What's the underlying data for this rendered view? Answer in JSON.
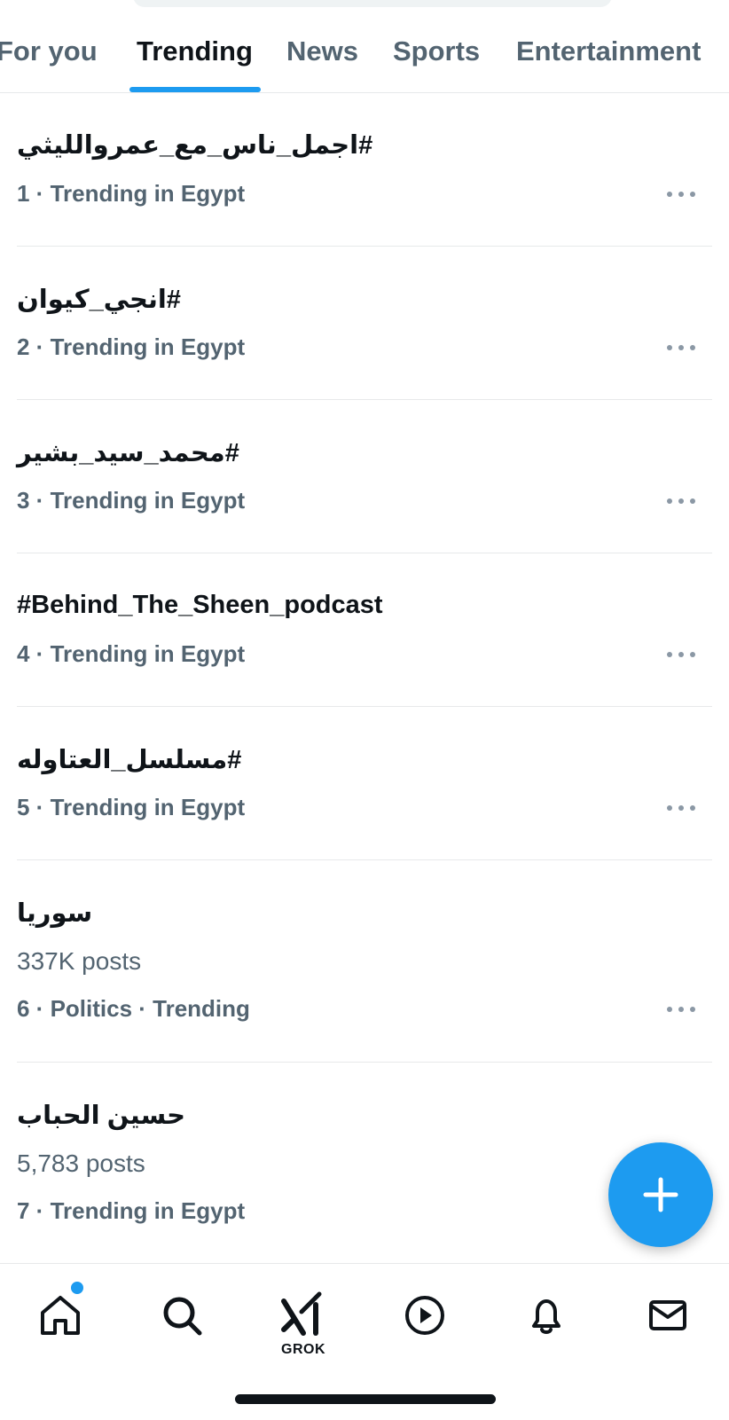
{
  "tabs": [
    {
      "label": "For you",
      "active": false
    },
    {
      "label": "Trending",
      "active": true
    },
    {
      "label": "News",
      "active": false
    },
    {
      "label": "Sports",
      "active": false
    },
    {
      "label": "Entertainment",
      "active": false
    }
  ],
  "trends": [
    {
      "title": "#اجمل_ناس_مع_عمروالليثي",
      "posts": "",
      "meta": "1 · Trending in Egypt"
    },
    {
      "title": "#انجي_كيوان",
      "posts": "",
      "meta": "2 · Trending in Egypt"
    },
    {
      "title": "#محمد_سيد_بشير",
      "posts": "",
      "meta": "3 · Trending in Egypt"
    },
    {
      "title": "#Behind_The_Sheen_podcast",
      "posts": "",
      "meta": "4 · Trending in Egypt"
    },
    {
      "title": "#مسلسل_العتاوله",
      "posts": "",
      "meta": "5 · Trending in Egypt"
    },
    {
      "title": "سوريا",
      "posts": "337K posts",
      "meta": "6 · Politics · Trending"
    },
    {
      "title": "حسين الحباب",
      "posts": "5,783 posts",
      "meta": "7 · Trending in Egypt"
    }
  ],
  "bottom_nav": {
    "home_icon": "home-icon",
    "search_icon": "search-icon",
    "grok_label": "GROK",
    "video_icon": "play-circle-icon",
    "notifications_icon": "bell-icon",
    "messages_icon": "envelope-icon",
    "home_has_notification_dot": true
  },
  "compose": {
    "icon": "plus-icon"
  },
  "colors": {
    "accent": "#1d9bf0",
    "text_primary": "#0f1419",
    "text_secondary": "#536471"
  }
}
